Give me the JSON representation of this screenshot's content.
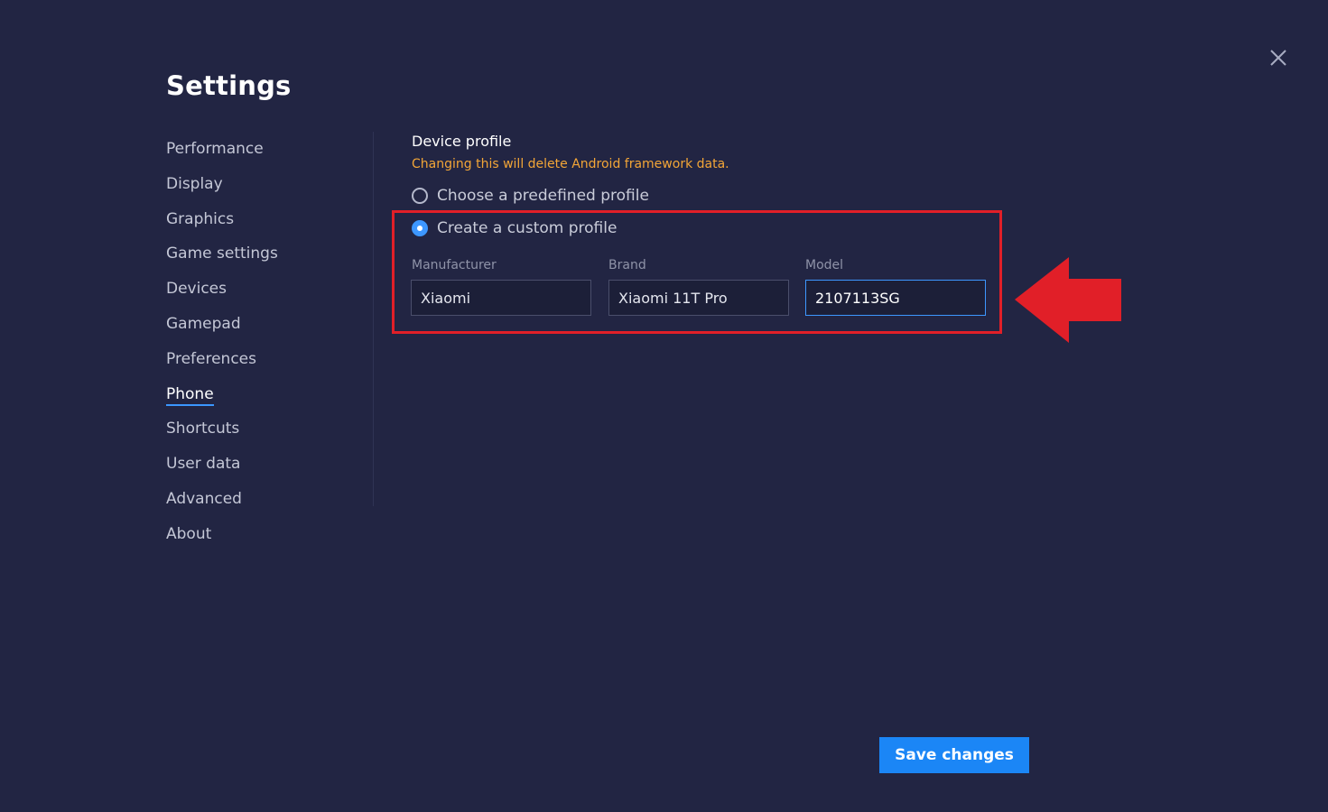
{
  "window": {
    "title": "Settings"
  },
  "sidebar": {
    "items": [
      {
        "label": "Performance"
      },
      {
        "label": "Display"
      },
      {
        "label": "Graphics"
      },
      {
        "label": "Game settings"
      },
      {
        "label": "Devices"
      },
      {
        "label": "Gamepad"
      },
      {
        "label": "Preferences"
      },
      {
        "label": "Phone",
        "active": true
      },
      {
        "label": "Shortcuts"
      },
      {
        "label": "User data"
      },
      {
        "label": "Advanced"
      },
      {
        "label": "About"
      }
    ]
  },
  "main": {
    "section_title": "Device profile",
    "warning": "Changing this will delete Android framework data.",
    "options": [
      {
        "label": "Choose a predefined profile",
        "selected": false
      },
      {
        "label": "Create a custom profile",
        "selected": true
      }
    ],
    "fields": {
      "manufacturer": {
        "label": "Manufacturer",
        "value": "Xiaomi"
      },
      "brand": {
        "label": "Brand",
        "value": "Xiaomi 11T Pro"
      },
      "model": {
        "label": "Model",
        "value": "2107113SG"
      }
    }
  },
  "footer": {
    "save_label": "Save changes"
  },
  "icons": {
    "close": "close-icon",
    "annotation": "red-arrow-left"
  },
  "colors": {
    "background": "#222543",
    "accent": "#1b86f6",
    "warning": "#f3a637",
    "highlight": "#e11f28"
  }
}
